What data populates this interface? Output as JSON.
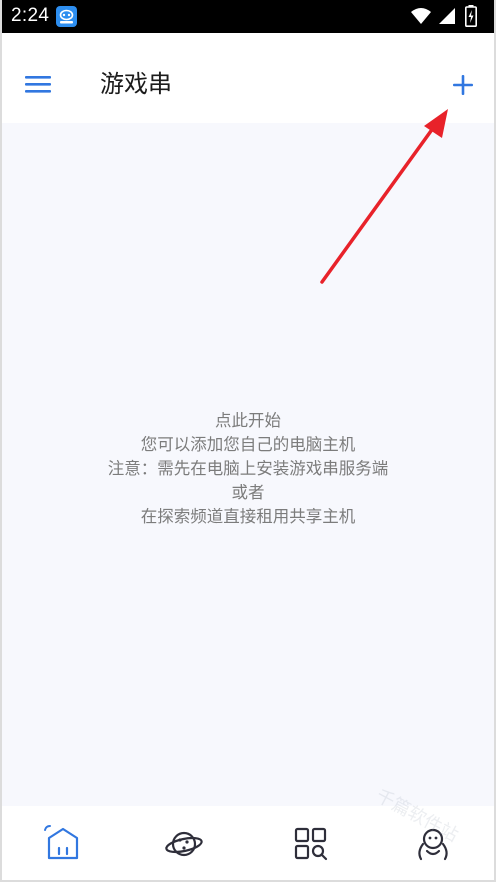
{
  "status_bar": {
    "time": "2:24",
    "app_icon": "game-app-icon",
    "indicators": [
      "wifi-icon",
      "signal-icon",
      "battery-charging-icon"
    ]
  },
  "app_bar": {
    "menu_icon": "menu-icon",
    "title": "游戏串",
    "add_icon": "add-icon"
  },
  "empty_state": {
    "lines": [
      "点此开始",
      "您可以添加您自己的电脑主机",
      "注意：需先在电脑上安装游戏串服务端",
      "或者",
      "在探索频道直接租用共享主机"
    ]
  },
  "bottom_nav": {
    "items": [
      {
        "icon": "home-icon",
        "active": true
      },
      {
        "icon": "planet-icon",
        "active": false
      },
      {
        "icon": "grid-search-icon",
        "active": false
      },
      {
        "icon": "profile-icon",
        "active": false
      }
    ]
  },
  "watermark": "千篇软件站",
  "colors": {
    "accent": "#3177e0",
    "annotation": "#e8222a",
    "content_bg": "#f7f8fd",
    "text_muted": "#7c7c7c",
    "icon_inactive": "#2e2e3a"
  }
}
